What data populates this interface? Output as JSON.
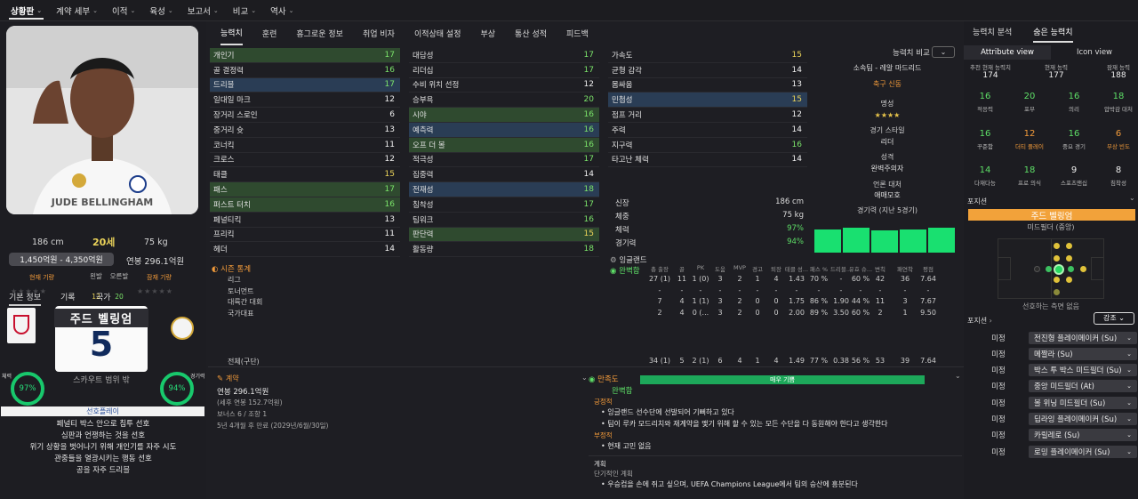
{
  "menu": [
    {
      "label": "상황판"
    },
    {
      "label": "계약 세부"
    },
    {
      "label": "이적"
    },
    {
      "label": "육성"
    },
    {
      "label": "보고서"
    },
    {
      "label": "비교"
    },
    {
      "label": "역사"
    }
  ],
  "player": {
    "name_on_shirt": "JUDE BELLINGHAM",
    "height": "186 cm",
    "age": "20세",
    "weight": "75 kg",
    "value_range": "1,450억원 - 4,350억원",
    "wage": "연봉 296.1억원",
    "current_ability_lbl": "현재 기량",
    "potential_ability_lbl": "잠재 기량",
    "left_foot_lbl": "왼발",
    "right_foot_lbl": "오른발",
    "left_foot": "12",
    "right_foot": "20",
    "shirt_name": "주드 벨링엄",
    "shirt_number": "5",
    "scout_range": "스카우트 범위 밖",
    "fitness_lbl": "체력",
    "fitness": "97%",
    "match_lbl": "경기력",
    "match": "94%",
    "pref_title": "선호플레이",
    "prefs": [
      "페널티 박스 안으로 침투 선호",
      "심판과 언쟁하는 것을 선호",
      "위기 상황을 벗어나기 위해 개인기를 자주 시도",
      "관중들을 열광시키는 행동 선호",
      "공을 자주 드리블"
    ]
  },
  "left_tabs": [
    "기본 정보",
    "기록",
    "국가"
  ],
  "mid_tabs": [
    "능력치",
    "훈련",
    "흥그로운 정보",
    "취업 비자",
    "이적상태 설정",
    "부상",
    "통산 성적",
    "피드백"
  ],
  "col1": [
    [
      "개인기",
      "17",
      "g",
      "hl"
    ],
    [
      "골 결정력",
      "16",
      "g",
      ""
    ],
    [
      "드리블",
      "17",
      "g",
      "hb"
    ],
    [
      "일대일 마크",
      "12",
      "w",
      ""
    ],
    [
      "장거리 스로인",
      "6",
      "w",
      ""
    ],
    [
      "중거리 슛",
      "13",
      "w",
      ""
    ],
    [
      "코너킥",
      "11",
      "w",
      ""
    ],
    [
      "크로스",
      "12",
      "w",
      ""
    ],
    [
      "태클",
      "15",
      "y",
      ""
    ],
    [
      "패스",
      "17",
      "g",
      "hl"
    ],
    [
      "퍼스트 터치",
      "16",
      "g",
      "hl"
    ],
    [
      "페널티킥",
      "13",
      "w",
      ""
    ],
    [
      "프리킥",
      "11",
      "w",
      ""
    ],
    [
      "헤더",
      "14",
      "w",
      ""
    ]
  ],
  "col2": [
    [
      "대담성",
      "17",
      "g",
      ""
    ],
    [
      "리더십",
      "17",
      "g",
      ""
    ],
    [
      "수비 위치 선정",
      "12",
      "w",
      ""
    ],
    [
      "승부욕",
      "20",
      "g",
      ""
    ],
    [
      "시야",
      "16",
      "g",
      "hl"
    ],
    [
      "예측력",
      "16",
      "g",
      "hb"
    ],
    [
      "오프 더 볼",
      "16",
      "g",
      "hl"
    ],
    [
      "적극성",
      "17",
      "g",
      ""
    ],
    [
      "집중력",
      "14",
      "w",
      ""
    ],
    [
      "전재성",
      "18",
      "g",
      "hb"
    ],
    [
      "침착성",
      "17",
      "g",
      ""
    ],
    [
      "팀워크",
      "16",
      "g",
      ""
    ],
    [
      "판단력",
      "15",
      "y",
      "hl"
    ],
    [
      "활동량",
      "18",
      "g",
      ""
    ]
  ],
  "col3": [
    [
      "가속도",
      "15",
      "y",
      ""
    ],
    [
      "균형 감각",
      "14",
      "w",
      ""
    ],
    [
      "몸싸움",
      "13",
      "w",
      ""
    ],
    [
      "민첩성",
      "15",
      "y",
      "hb"
    ],
    [
      "점프 거리",
      "12",
      "w",
      ""
    ],
    [
      "주력",
      "14",
      "w",
      ""
    ],
    [
      "지구력",
      "16",
      "g",
      ""
    ],
    [
      "타고난 체력",
      "14",
      "w",
      ""
    ]
  ],
  "bio": {
    "compare": "능력치 비교",
    "club": "소속팀 - 레알 마드리드",
    "role": "축구 신동",
    "fame_lbl": "명성",
    "stars": "★★★★",
    "style_lbl": "경기 스타일",
    "style": "리더",
    "personality_lbl": "성격",
    "personality": "완벽주의자",
    "media_lbl": "언론 대처",
    "media": "애매모호",
    "form_lbl": "경기력 (지난 5경기)"
  },
  "physical": [
    [
      "신장",
      "186 cm"
    ],
    [
      "체중",
      "75 kg"
    ],
    [
      "체력",
      "97%"
    ],
    [
      "경기력",
      "94%"
    ]
  ],
  "nation": "잉글랜드",
  "nation_status": "완벽함",
  "form_bars": [
    0.92,
    1,
    0.9,
    0.92,
    1
  ],
  "stats": {
    "title": "시즌 통계",
    "headers": [
      "총 출장",
      "골",
      "PK",
      "도움",
      "MVP",
      "경고",
      "퇴장",
      "테클 성...",
      "패스 %",
      "드리블...",
      "유효 슈...",
      "변칙",
      "패연착",
      "평점"
    ],
    "rows": [
      [
        "리그",
        "27 (1)",
        "11",
        "1 (0)",
        "3",
        "2",
        "1",
        "4",
        "1.43",
        "70 %",
        "-",
        "60 %",
        "42",
        "36",
        "7.64"
      ],
      [
        "토너먼트",
        "-",
        "-",
        "-",
        "-",
        "-",
        "-",
        "-",
        "-",
        "-",
        "-",
        "-",
        "-",
        "-",
        "-"
      ],
      [
        "대륙간 대회",
        "7",
        "4",
        "1 (1)",
        "3",
        "2",
        "0",
        "0",
        "1.75",
        "86 %",
        "1.90",
        "44 %",
        "11",
        "3",
        "7.67"
      ],
      [
        "국가대표",
        "2",
        "4",
        "0 (...",
        "3",
        "2",
        "0",
        "0",
        "2.00",
        "89 %",
        "3.50",
        "60 %",
        "2",
        "1",
        "9.50"
      ]
    ],
    "total": [
      "전체(구단)",
      "34 (1)",
      "5",
      "2 (1)",
      "6",
      "4",
      "1",
      "4",
      "1.49",
      "77 %",
      "0.38",
      "56 %",
      "53",
      "39",
      "7.64"
    ]
  },
  "contract": {
    "title": "계약",
    "wage": "연봉 296.1억원",
    "wage_sub": "(세후 연봉 152.7억원)",
    "bonus": "보너스 6 / 조항 1",
    "expiry": "5년 4개월 후 만료 (2029년/6월/30일)"
  },
  "happy": {
    "title": "만족도",
    "bar": "매우 기쁨",
    "state": "완벽함",
    "pos_lbl": "긍정적",
    "pos": [
      "잉글랜드 선수단에 선발되어 기뻐하고 있다",
      "팀이 루카 모드리치와 재계약을 맺기 위해 할 수 있는 모든 수단을 다 동원해야 한다고 생각한다"
    ],
    "neg_lbl": "부정적",
    "neg": [
      "현재 고민 없음"
    ],
    "plan_lbl": "계획",
    "plan_sub": "단기적인 계획",
    "plan": [
      "우승컵을 손에 쥐고 싶으며, UEFA Champions League에서 팀의 승산에 흥분된다"
    ]
  },
  "right": {
    "tabs": [
      "능력치 분석",
      "숨은 능력치"
    ],
    "views": [
      "Attribute view",
      "Icon view"
    ],
    "abil": [
      [
        "추천 현재 능력치",
        "174"
      ],
      [
        "현재 능력",
        "177"
      ],
      [
        "잠재 능력",
        "188"
      ]
    ],
    "hidden": [
      [
        "16",
        "적응력",
        "g"
      ],
      [
        "20",
        "포부",
        "g"
      ],
      [
        "16",
        "의리",
        "g"
      ],
      [
        "18",
        "압박감 대처",
        "g"
      ],
      [
        "16",
        "꾸준함",
        "g"
      ],
      [
        "12",
        "더티 플레이",
        "o"
      ],
      [
        "16",
        "중요 경기",
        "g"
      ],
      [
        "6",
        "부상 빈도",
        "o"
      ],
      [
        "14",
        "다재다능",
        "g"
      ],
      [
        "18",
        "프로 의식",
        "g"
      ],
      [
        "9",
        "스포츠맨십",
        "w"
      ],
      [
        "8",
        "침착성",
        "w"
      ],
      [
        "12",
        "논쟁성",
        "o"
      ]
    ],
    "pos_lbl": "포지션",
    "pos_name": "주드 벨링엄",
    "pos_role": "미드필더 (중앙)",
    "pos_side": "선호하는 측면 없음",
    "role_lbl": "포지션",
    "emph": "강조",
    "roles": [
      [
        "미정",
        "전진형 플레이메이커 (Su)"
      ],
      [
        "미정",
        "메짤라 (Su)"
      ],
      [
        "미정",
        "박스 투 박스 미드필더 (Su)"
      ],
      [
        "미정",
        "중앙 미드필더 (At)"
      ],
      [
        "미정",
        "볼 위닝 미드필더 (Su)"
      ],
      [
        "미정",
        "딥라잉 플레이메이커 (Su)"
      ],
      [
        "미정",
        "카릴레로 (Su)"
      ],
      [
        "미정",
        "로밍 플레이메이커 (Su)"
      ]
    ]
  },
  "colors": {
    "green": "#5edf67",
    "yellow": "#ecd45a",
    "orange": "#f39b3a"
  }
}
